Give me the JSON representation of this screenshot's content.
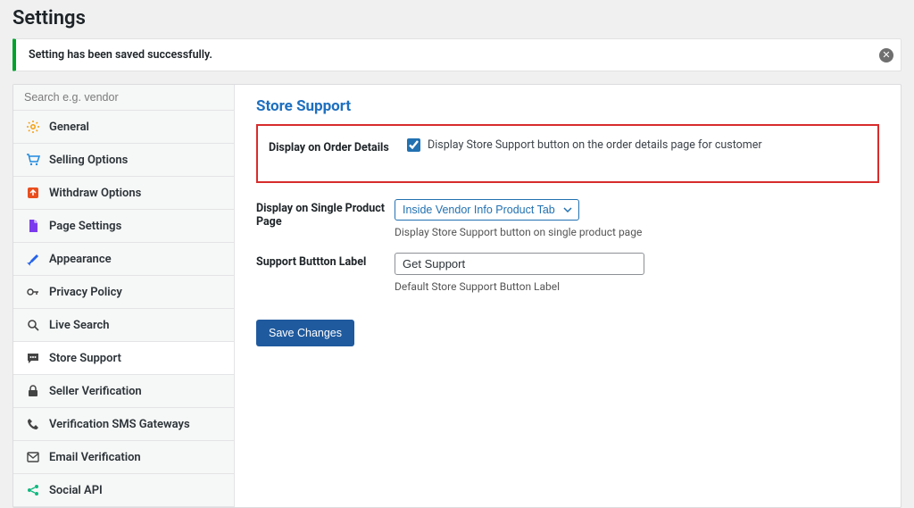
{
  "page_title": "Settings",
  "notice": {
    "message": "Setting has been saved successfully."
  },
  "search": {
    "placeholder": "Search e.g. vendor"
  },
  "sidebar": {
    "items": [
      {
        "label": "General",
        "icon": "gear",
        "color": "#f59e0b"
      },
      {
        "label": "Selling Options",
        "icon": "cart",
        "color": "#1f8ae0"
      },
      {
        "label": "Withdraw Options",
        "icon": "arrow-up",
        "color": "#e94f1e"
      },
      {
        "label": "Page Settings",
        "icon": "page",
        "color": "#7c3aed"
      },
      {
        "label": "Appearance",
        "icon": "brush",
        "color": "#2563eb"
      },
      {
        "label": "Privacy Policy",
        "icon": "key",
        "color": "#444444"
      },
      {
        "label": "Live Search",
        "icon": "search",
        "color": "#444444"
      },
      {
        "label": "Store Support",
        "icon": "chat",
        "color": "#444444",
        "active": true
      },
      {
        "label": "Seller Verification",
        "icon": "lock",
        "color": "#444444"
      },
      {
        "label": "Verification SMS Gateways",
        "icon": "phone",
        "color": "#444444"
      },
      {
        "label": "Email Verification",
        "icon": "mail",
        "color": "#444444"
      },
      {
        "label": "Social API",
        "icon": "share",
        "color": "#10b981"
      }
    ]
  },
  "section": {
    "title": "Store Support",
    "fields": {
      "display_order": {
        "label": "Display on Order Details",
        "checkbox_label": "Display Store Support button on the order details page for customer",
        "checked": true
      },
      "display_single": {
        "label": "Display on Single Product Page",
        "selected": "Inside Vendor Info Product Tab",
        "helper": "Display Store Support button on single product page"
      },
      "button_label": {
        "label": "Support Buttton Label",
        "value": "Get Support",
        "helper": "Default Store Support Button Label"
      }
    },
    "save_button": "Save Changes"
  }
}
